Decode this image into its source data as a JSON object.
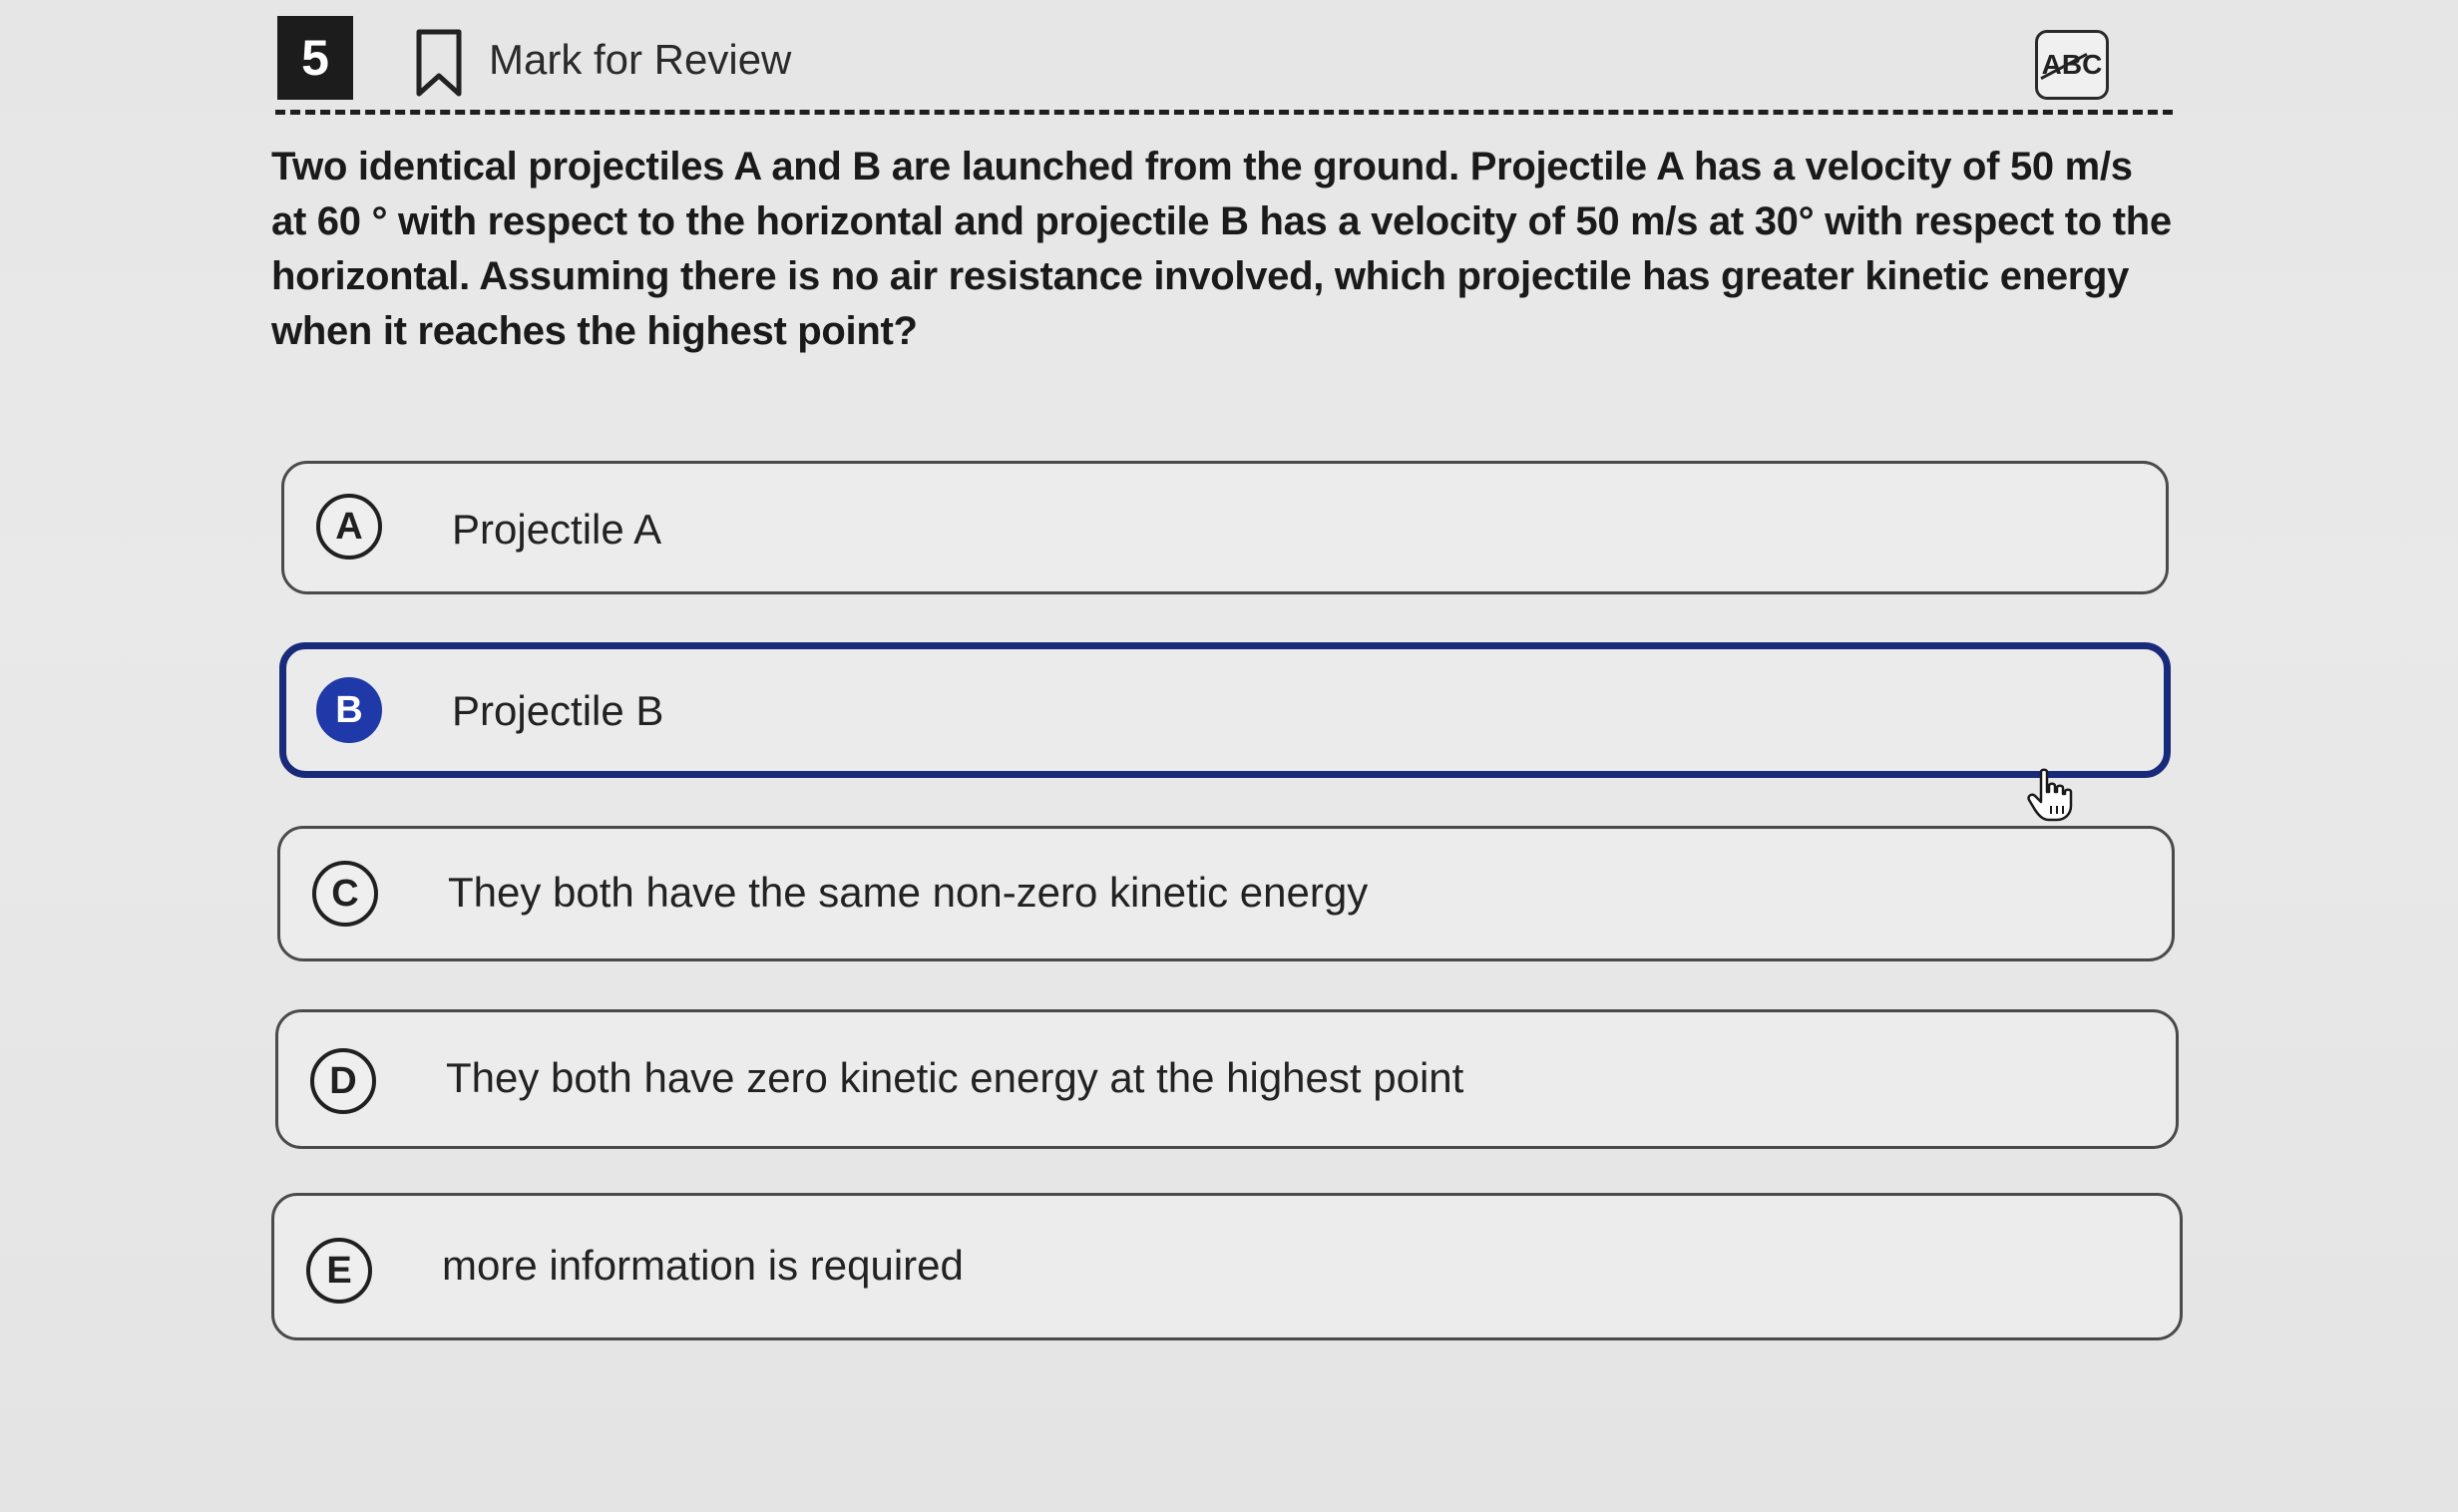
{
  "header": {
    "question_number": "5",
    "mark_for_review_label": "Mark for Review",
    "abc_label": "ABC"
  },
  "question": {
    "text": "Two identical projectiles A and B are launched from the ground. Projectile A has a velocity of 50 m/s at 60 ° with respect to the horizontal and projectile B has a velocity of 50 m/s at 30° with respect to the horizontal. Assuming there is no air resistance involved, which projectile has greater kinetic energy when it reaches the highest point?"
  },
  "choices": [
    {
      "letter": "A",
      "text": "Projectile A",
      "selected": false
    },
    {
      "letter": "B",
      "text": "Projectile B",
      "selected": true
    },
    {
      "letter": "C",
      "text": "They both have the same non-zero kinetic energy",
      "selected": false
    },
    {
      "letter": "D",
      "text": "They both have zero kinetic energy at the highest point",
      "selected": false
    },
    {
      "letter": "E",
      "text": "more information is required",
      "selected": false
    }
  ],
  "colors": {
    "selected_accent": "#1f3aa8",
    "selected_border": "#1a2a7a",
    "question_number_bg": "#1c1c1c"
  },
  "icons": {
    "bookmark": "bookmark-icon",
    "abc": "strikethrough-abc-icon",
    "cursor": "hand-pointer-icon"
  }
}
